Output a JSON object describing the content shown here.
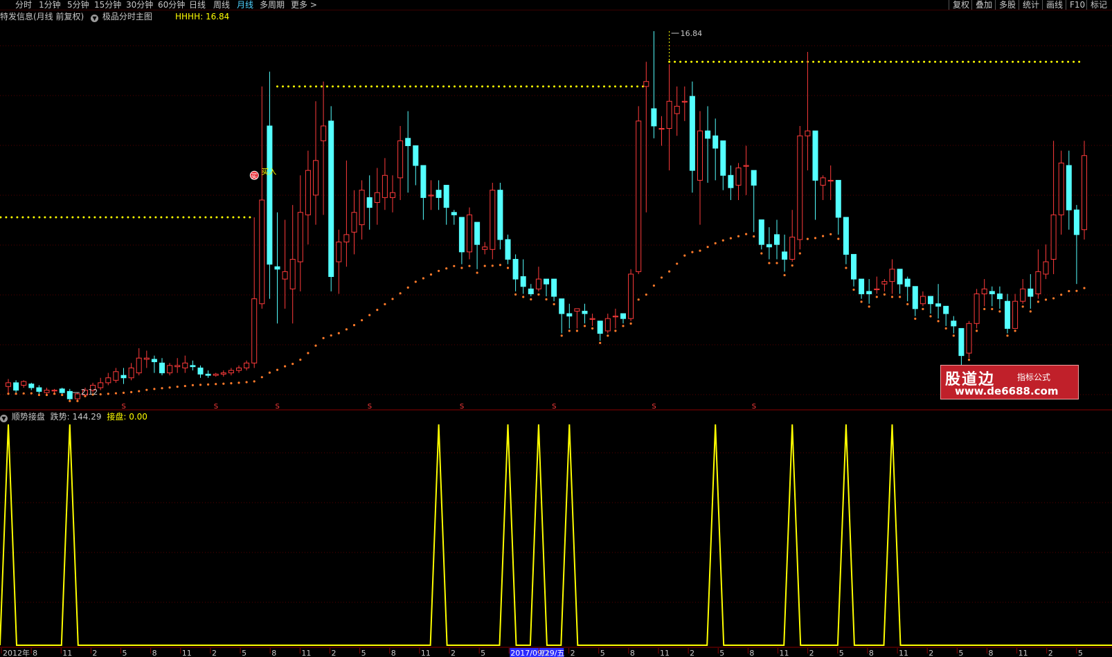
{
  "toolbar": {
    "periods": [
      "分时",
      "1分钟",
      "5分钟",
      "15分钟",
      "30分钟",
      "60分钟",
      "日线",
      "周线",
      "月线",
      "多周期",
      "更多 >"
    ],
    "active_period": "月线",
    "right_buttons": [
      "复权",
      "叠加",
      "多股",
      "统计",
      "画线",
      "F10",
      "标记"
    ]
  },
  "main_panel": {
    "title": "特发信息(月线 前复权)",
    "indicator_name": "极品分时主图",
    "hhhh_label": "HHHH: 16.84",
    "high_marker": "16.84",
    "low_marker": "2.12",
    "buy_label": "买入",
    "buy_icon": "买",
    "s_marker": "S"
  },
  "sub_panel": {
    "indicator_name": "顺势接盘",
    "trend_label": "跌势: 144.29",
    "catch_label": "接盘: 0.00"
  },
  "x_axis": {
    "labels": [
      "2012年",
      "8",
      "11",
      "2",
      "5",
      "8",
      "11",
      "2",
      "5",
      "8",
      "11",
      "2",
      "5",
      "8",
      "11",
      "2",
      "5",
      "2017/09/29/五",
      "11",
      "2",
      "5",
      "8",
      "11",
      "2",
      "5",
      "8",
      "11",
      "2",
      "5",
      "8",
      "11",
      "2",
      "5",
      "8",
      "11",
      "2",
      "5"
    ]
  },
  "watermark": {
    "logo": "股道边",
    "sub": "指标公式",
    "url": "www.de6688.com"
  },
  "colors": {
    "up": "#ff3b3b",
    "down": "#54ffff",
    "yellow": "#ffff00",
    "sar": "#ff7a2a",
    "grid": "#5a0000",
    "axis_date": "#2a2aff"
  },
  "chart_data": [
    {
      "type": "candlestick",
      "price_high": 16.84,
      "price_low": 2.12,
      "ohlc": [
        [
          2.45,
          2.6,
          2.2,
          2.75
        ],
        [
          2.6,
          2.3,
          2.2,
          2.7
        ],
        [
          2.5,
          2.65,
          2.4,
          2.7
        ],
        [
          2.55,
          2.4,
          2.3,
          2.6
        ],
        [
          2.4,
          2.25,
          2.15,
          2.5
        ],
        [
          2.2,
          2.3,
          2.15,
          2.4
        ],
        [
          2.3,
          2.3,
          2.2,
          2.35
        ],
        [
          2.35,
          2.2,
          2.15,
          2.4
        ],
        [
          2.25,
          1.95,
          1.9,
          2.35
        ],
        [
          1.95,
          2.15,
          1.9,
          2.2
        ],
        [
          2.1,
          2.3,
          2.1,
          2.4
        ],
        [
          2.3,
          2.5,
          2.2,
          2.6
        ],
        [
          2.4,
          2.6,
          2.3,
          2.8
        ],
        [
          2.6,
          2.8,
          2.5,
          3.0
        ],
        [
          2.7,
          3.05,
          2.6,
          3.2
        ],
        [
          2.9,
          2.8,
          2.55,
          3.2
        ],
        [
          2.8,
          3.2,
          2.7,
          3.4
        ],
        [
          3.0,
          3.6,
          2.9,
          4.0
        ],
        [
          3.55,
          3.6,
          3.2,
          3.9
        ],
        [
          3.55,
          3.45,
          3.0,
          3.7
        ],
        [
          3.4,
          3.0,
          2.9,
          3.6
        ],
        [
          3.0,
          3.3,
          2.9,
          3.4
        ],
        [
          3.25,
          3.3,
          3.0,
          3.6
        ],
        [
          3.2,
          3.4,
          3.0,
          3.7
        ],
        [
          3.3,
          3.25,
          3.1,
          3.5
        ],
        [
          3.2,
          2.95,
          2.8,
          3.3
        ],
        [
          2.95,
          2.9,
          2.8,
          3.1
        ],
        [
          2.9,
          2.95,
          2.85,
          3.0
        ],
        [
          2.95,
          3.0,
          2.85,
          3.1
        ],
        [
          3.0,
          3.1,
          2.9,
          3.2
        ],
        [
          3.1,
          3.2,
          3.0,
          3.3
        ],
        [
          3.2,
          3.4,
          3.1,
          3.5
        ],
        [
          3.4,
          6.0,
          3.2,
          9.3
        ],
        [
          5.8,
          10.0,
          5.6,
          14.6
        ],
        [
          13.0,
          7.4,
          6.0,
          15.2
        ],
        [
          7.3,
          7.2,
          5.0,
          9.5
        ],
        [
          6.8,
          7.1,
          5.6,
          9.2
        ],
        [
          6.4,
          7.6,
          5.0,
          9.8
        ],
        [
          7.5,
          9.5,
          6.3,
          11.0
        ],
        [
          9.4,
          11.2,
          8.2,
          12.0
        ],
        [
          10.2,
          11.6,
          9.0,
          14.0
        ],
        [
          12.4,
          13.0,
          9.4,
          14.8
        ],
        [
          13.2,
          6.9,
          6.3,
          13.8
        ],
        [
          7.5,
          8.3,
          6.2,
          8.8
        ],
        [
          8.3,
          8.6,
          7.3,
          11.6
        ],
        [
          8.7,
          9.5,
          7.8,
          10.4
        ],
        [
          9.0,
          10.4,
          8.4,
          10.8
        ],
        [
          10.1,
          9.7,
          8.8,
          11.0
        ],
        [
          9.9,
          10.3,
          9.0,
          11.3
        ],
        [
          10.1,
          11.0,
          9.6,
          11.7
        ],
        [
          10.1,
          10.3,
          9.5,
          11.0
        ],
        [
          10.9,
          12.4,
          10.0,
          13.0
        ],
        [
          12.5,
          12.2,
          10.3,
          13.6
        ],
        [
          12.2,
          11.4,
          10.6,
          12.2
        ],
        [
          11.4,
          10.1,
          9.2,
          11.4
        ],
        [
          10.2,
          10.2,
          9.6,
          10.8
        ],
        [
          10.4,
          10.1,
          9.6,
          10.8
        ],
        [
          10.6,
          9.7,
          9.0,
          10.6
        ],
        [
          9.5,
          9.4,
          9.0,
          9.6
        ],
        [
          9.3,
          7.9,
          7.4,
          9.3
        ],
        [
          7.9,
          9.4,
          7.6,
          9.7
        ],
        [
          9.1,
          8.2,
          7.2,
          9.1
        ],
        [
          8.0,
          8.1,
          7.8,
          8.3
        ],
        [
          8.0,
          10.4,
          7.6,
          10.7
        ],
        [
          10.4,
          8.4,
          8.0,
          10.7
        ],
        [
          8.4,
          7.6,
          7.4,
          8.6
        ],
        [
          7.6,
          6.8,
          6.3,
          7.8
        ],
        [
          6.9,
          6.5,
          6.2,
          7.6
        ],
        [
          6.4,
          6.2,
          6.1,
          6.6
        ],
        [
          6.4,
          6.8,
          6.3,
          7.3
        ],
        [
          6.8,
          6.6,
          6.1,
          6.8
        ],
        [
          6.8,
          6.1,
          5.9,
          6.8
        ],
        [
          6.0,
          5.4,
          4.6,
          6.0
        ],
        [
          5.4,
          5.3,
          4.8,
          5.8
        ],
        [
          5.5,
          5.6,
          4.8,
          5.6
        ],
        [
          5.5,
          5.4,
          5.0,
          5.8
        ],
        [
          5.2,
          5.2,
          4.9,
          5.4
        ],
        [
          5.1,
          4.6,
          4.3,
          5.1
        ],
        [
          4.7,
          5.2,
          4.6,
          5.4
        ],
        [
          5.3,
          5.3,
          4.8,
          5.6
        ],
        [
          5.4,
          5.2,
          5.0,
          5.4
        ],
        [
          5.2,
          7.0,
          5.1,
          7.2
        ],
        [
          7.1,
          13.2,
          7.0,
          13.8
        ],
        [
          14.6,
          14.8,
          9.5,
          15.6
        ],
        [
          13.7,
          13.0,
          12.5,
          16.84
        ],
        [
          12.9,
          12.9,
          12.2,
          13.4
        ],
        [
          12.9,
          14.0,
          11.2,
          15.5
        ],
        [
          13.5,
          13.8,
          12.6,
          14.6
        ],
        [
          14.0,
          14.0,
          13.2,
          14.6
        ],
        [
          14.2,
          11.2,
          10.3,
          14.8
        ],
        [
          10.8,
          12.8,
          9.0,
          13.6
        ],
        [
          12.8,
          12.5,
          10.7,
          13.8
        ],
        [
          12.6,
          12.1,
          10.8,
          13.3
        ],
        [
          12.4,
          11.0,
          10.4,
          12.4
        ],
        [
          11.0,
          10.5,
          10.0,
          11.4
        ],
        [
          10.6,
          11.3,
          10.0,
          11.5
        ],
        [
          11.4,
          11.4,
          10.2,
          12.2
        ],
        [
          11.2,
          10.6,
          8.7,
          11.2
        ],
        [
          9.2,
          8.2,
          8.0,
          9.2
        ],
        [
          8.2,
          8.1,
          7.6,
          8.9
        ],
        [
          8.6,
          8.2,
          7.6,
          9.2
        ],
        [
          7.9,
          7.6,
          7.1,
          8.6
        ],
        [
          7.6,
          8.5,
          7.5,
          9.6
        ],
        [
          8.4,
          12.6,
          8.0,
          13.0
        ],
        [
          12.6,
          12.8,
          11.2,
          16.0
        ],
        [
          12.8,
          10.8,
          9.2,
          12.8
        ],
        [
          10.6,
          10.9,
          10.0,
          11.0
        ],
        [
          10.8,
          10.8,
          10.0,
          11.4
        ],
        [
          10.8,
          9.3,
          8.6,
          10.8
        ],
        [
          9.3,
          7.8,
          7.4,
          9.3
        ],
        [
          7.8,
          6.8,
          6.5,
          7.8
        ],
        [
          6.8,
          6.2,
          6.0,
          6.8
        ],
        [
          6.3,
          6.2,
          5.8,
          6.8
        ],
        [
          6.4,
          6.4,
          6.2,
          6.9
        ],
        [
          6.6,
          6.7,
          6.3,
          6.8
        ],
        [
          6.7,
          7.2,
          6.2,
          7.6
        ],
        [
          7.2,
          6.6,
          6.2,
          7.2
        ],
        [
          6.8,
          6.5,
          5.9,
          6.9
        ],
        [
          6.5,
          5.6,
          5.3,
          6.5
        ],
        [
          5.8,
          6.1,
          5.7,
          6.3
        ],
        [
          6.1,
          5.8,
          5.4,
          6.1
        ],
        [
          5.8,
          5.7,
          5.2,
          6.6
        ],
        [
          5.7,
          5.4,
          4.9,
          5.7
        ],
        [
          5.1,
          4.9,
          4.6,
          5.3
        ],
        [
          4.8,
          3.7,
          3.2,
          4.8
        ],
        [
          3.8,
          5.0,
          3.6,
          5.1
        ],
        [
          5.0,
          6.2,
          4.8,
          6.4
        ],
        [
          6.2,
          6.4,
          5.7,
          6.8
        ],
        [
          6.3,
          6.2,
          5.7,
          6.5
        ],
        [
          6.2,
          6.0,
          5.6,
          6.5
        ],
        [
          5.9,
          4.8,
          4.6,
          6.2
        ],
        [
          4.8,
          5.9,
          4.8,
          6.2
        ],
        [
          5.9,
          6.4,
          5.8,
          6.8
        ],
        [
          6.4,
          6.1,
          5.6,
          7.0
        ],
        [
          6.2,
          7.1,
          6.0,
          8.0
        ],
        [
          7.0,
          7.5,
          6.8,
          8.2
        ],
        [
          7.6,
          9.4,
          7.0,
          12.4
        ],
        [
          9.4,
          11.5,
          8.6,
          12.0
        ],
        [
          11.4,
          9.6,
          8.8,
          12.0
        ],
        [
          9.6,
          8.6,
          6.6,
          9.8
        ],
        [
          8.8,
          11.8,
          8.4,
          12.4
        ]
      ]
    },
    {
      "type": "line",
      "name": "跌势",
      "value": 144.29,
      "peak_bars": [
        0,
        8,
        56,
        65,
        69,
        73,
        92,
        102,
        109,
        115
      ]
    }
  ]
}
